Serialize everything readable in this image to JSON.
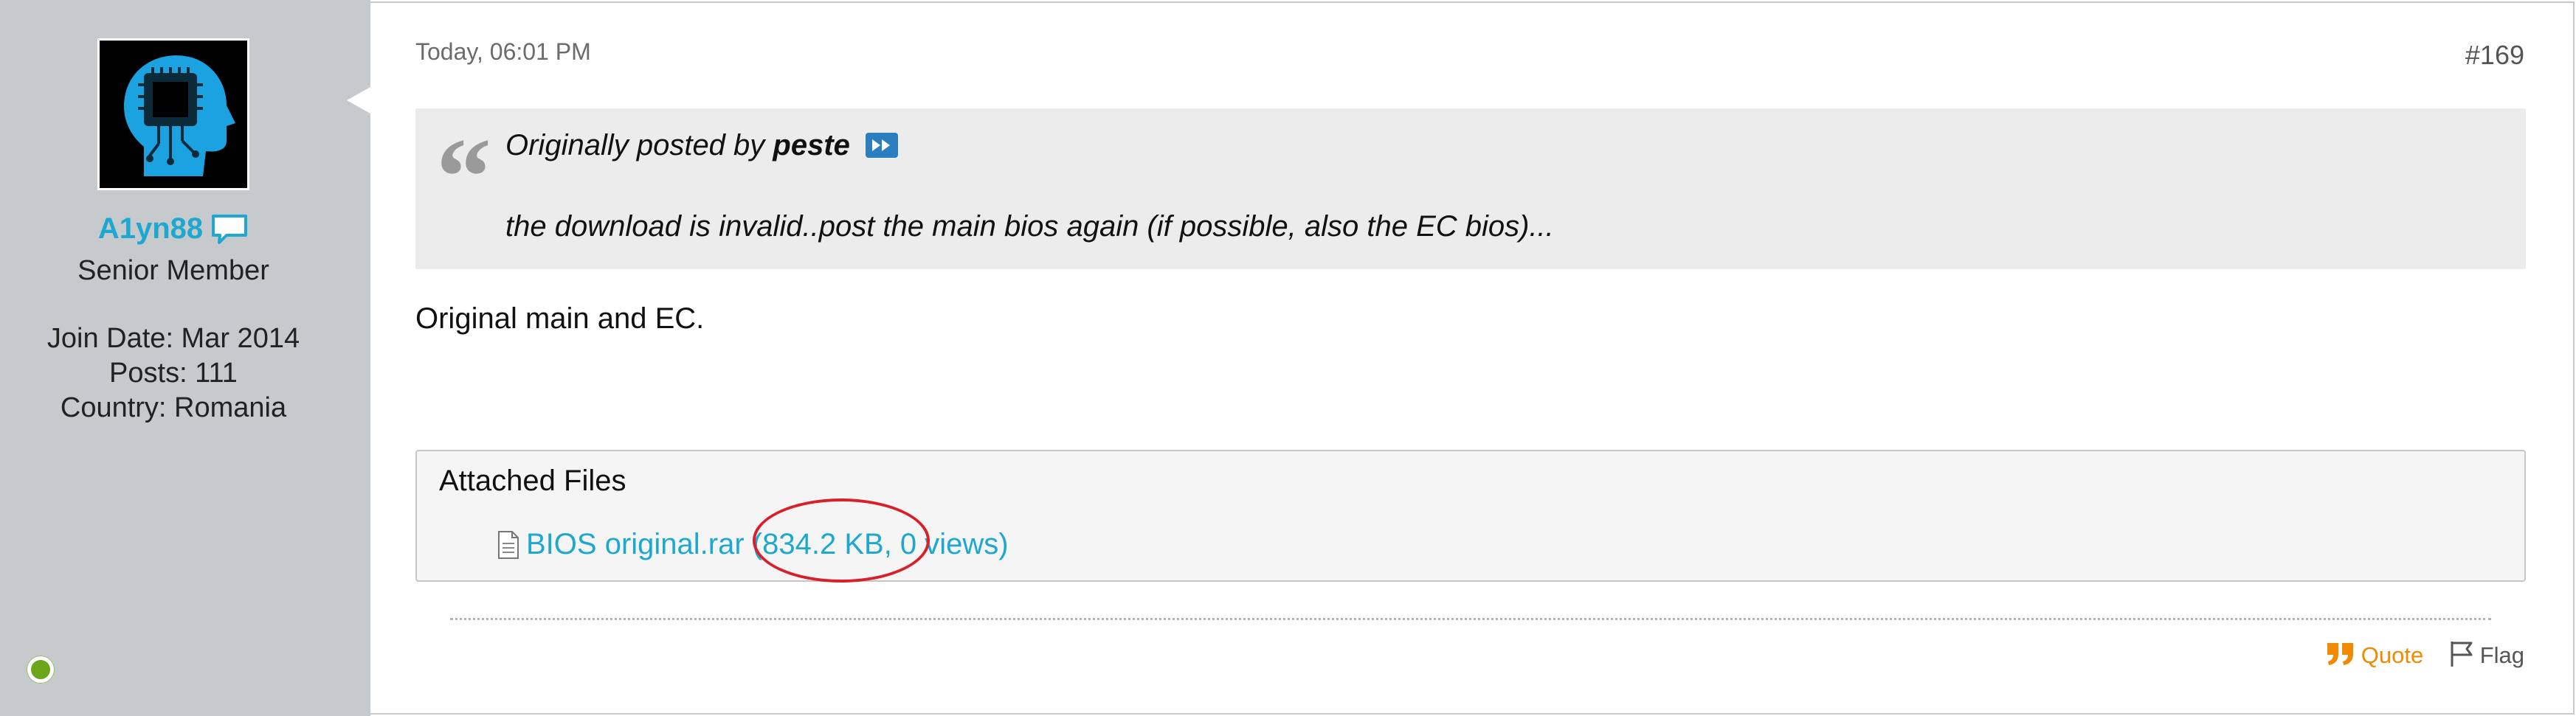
{
  "user": {
    "username": "A1yn88",
    "title": "Senior Member",
    "join_date": "Join Date: Mar 2014",
    "posts": "Posts: 111",
    "country": "Country: Romania",
    "status": "online",
    "status_color": "#6aa51a",
    "avatar_icon": "head-with-chip-icon"
  },
  "post": {
    "date": "Today, 06:01 PM",
    "number": "#169",
    "quote": {
      "prefix": "Originally posted by",
      "author": "peste",
      "text": "the download is invalid..post the main bios again (if possible, also the EC bios)..."
    },
    "body": "Original main and EC.",
    "attachments": {
      "title": "Attached Files",
      "files": [
        {
          "name": "BIOS original.rar",
          "meta": "(834.2 KB, 0 views)"
        }
      ]
    },
    "actions": {
      "quote_label": "Quote",
      "flag_label": "Flag"
    }
  },
  "colors": {
    "link": "#1ea8d0",
    "quote_action": "#f08a00",
    "annotation": "#d8202a",
    "sidebar_bg": "#c6cacd"
  }
}
